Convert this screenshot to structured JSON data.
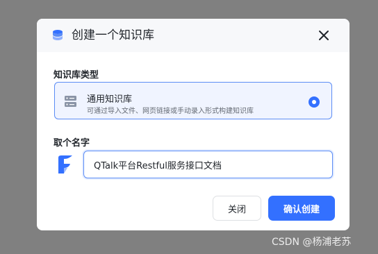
{
  "dialog": {
    "title": "创建一个知识库",
    "title_icon": "database-icon",
    "close_icon": "close-icon"
  },
  "type_section": {
    "label": "知识库类型",
    "option": {
      "icon": "server-icon",
      "name": "通用知识库",
      "description": "可通过导入文件、网页链接或手动录入形式构建知识库",
      "selected": true
    }
  },
  "name_section": {
    "label": "取个名字",
    "avatar_icon": "app-logo-icon",
    "input_value": "QTalk平台Restful服务接口文档"
  },
  "actions": {
    "close_label": "关闭",
    "create_label": "确认创建"
  },
  "watermark": "CSDN @杨浦老苏",
  "colors": {
    "accent": "#3370ff",
    "overlay": "#808080",
    "selected_bg": "#f0f4ff"
  }
}
